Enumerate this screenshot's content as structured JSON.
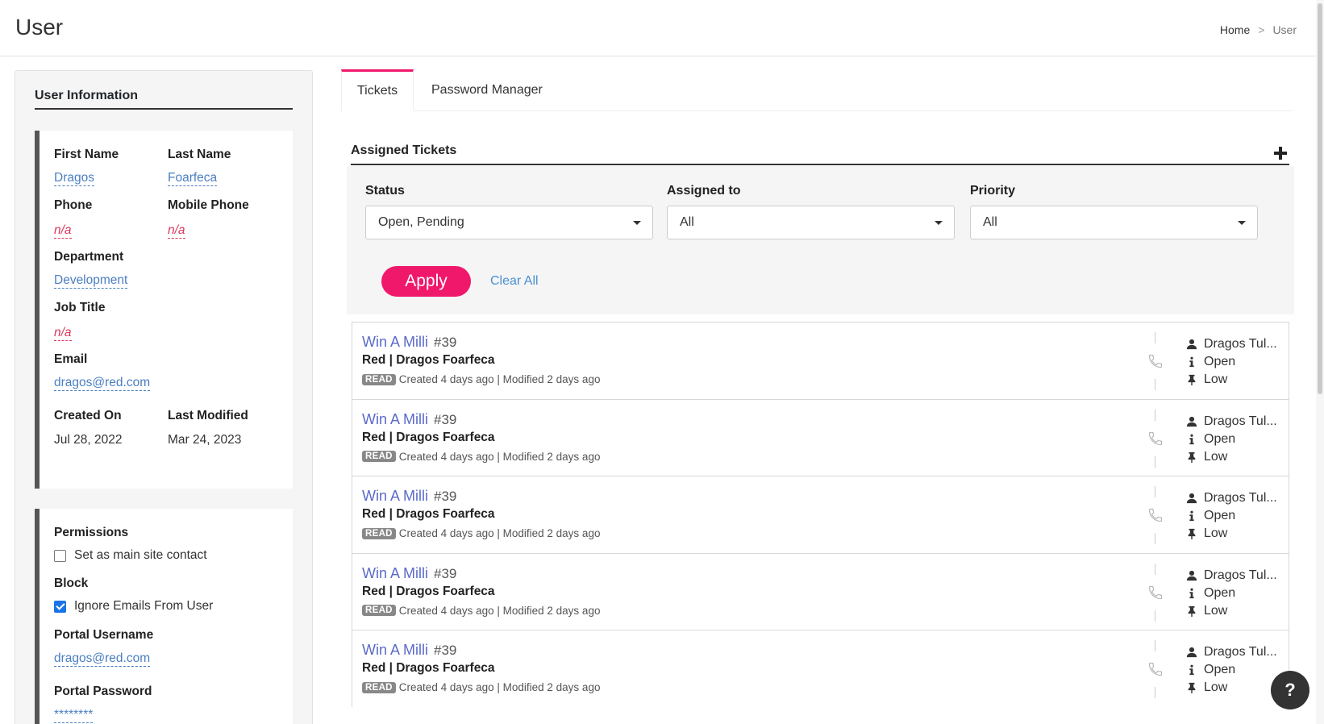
{
  "header": {
    "title": "User",
    "breadcrumb": {
      "home": "Home",
      "separator": ">",
      "current": "User"
    }
  },
  "user_info": {
    "section_title": "User Information",
    "first_name": {
      "label": "First Name",
      "value": "Dragos"
    },
    "last_name": {
      "label": "Last Name",
      "value": "Foarfeca"
    },
    "phone": {
      "label": "Phone",
      "value": "n/a"
    },
    "mobile_phone": {
      "label": "Mobile Phone",
      "value": "n/a"
    },
    "department": {
      "label": "Department",
      "value": "Development"
    },
    "job_title": {
      "label": "Job Title",
      "value": "n/a"
    },
    "email": {
      "label": "Email",
      "value": "dragos@red.com"
    },
    "created_on": {
      "label": "Created On",
      "value": "Jul 28, 2022"
    },
    "last_modified": {
      "label": "Last Modified",
      "value": "Mar 24, 2023"
    }
  },
  "permissions": {
    "label": "Permissions",
    "main_contact": {
      "label": "Set as main site contact",
      "checked": false
    },
    "block_label": "Block",
    "ignore_emails": {
      "label": "Ignore Emails From User",
      "checked": true
    },
    "portal_username": {
      "label": "Portal Username",
      "value": "dragos@red.com"
    },
    "portal_password": {
      "label": "Portal Password",
      "value": "********"
    }
  },
  "tabs": [
    {
      "label": "Tickets",
      "active": true
    },
    {
      "label": "Password Manager",
      "active": false
    }
  ],
  "tickets_section": {
    "title": "Assigned Tickets",
    "filters": {
      "status": {
        "label": "Status",
        "value": "Open, Pending"
      },
      "assigned_to": {
        "label": "Assigned to",
        "value": "All"
      },
      "priority": {
        "label": "Priority",
        "value": "All"
      }
    },
    "apply_label": "Apply",
    "clear_label": "Clear All"
  },
  "tickets": [
    {
      "title": "Win A Milli",
      "number": "#39",
      "subtitle": "Red | Dragos Foarfeca",
      "badge": "READ",
      "meta": "Created 4 days ago | Modified 2 days ago",
      "assignee": "Dragos Tul...",
      "status": "Open",
      "priority": "Low"
    },
    {
      "title": "Win A Milli",
      "number": "#39",
      "subtitle": "Red | Dragos Foarfeca",
      "badge": "READ",
      "meta": "Created 4 days ago | Modified 2 days ago",
      "assignee": "Dragos Tul...",
      "status": "Open",
      "priority": "Low"
    },
    {
      "title": "Win A Milli",
      "number": "#39",
      "subtitle": "Red | Dragos Foarfeca",
      "badge": "READ",
      "meta": "Created 4 days ago | Modified 2 days ago",
      "assignee": "Dragos Tul...",
      "status": "Open",
      "priority": "Low"
    },
    {
      "title": "Win A Milli",
      "number": "#39",
      "subtitle": "Red | Dragos Foarfeca",
      "badge": "READ",
      "meta": "Created 4 days ago | Modified 2 days ago",
      "assignee": "Dragos Tul...",
      "status": "Open",
      "priority": "Low"
    },
    {
      "title": "Win A Milli",
      "number": "#39",
      "subtitle": "Red | Dragos Foarfeca",
      "badge": "READ",
      "meta": "Created 4 days ago | Modified 2 days ago",
      "assignee": "Dragos Tul...",
      "status": "Open",
      "priority": "Low"
    }
  ],
  "help": {
    "label": "?"
  },
  "icons": {
    "add": "plus-icon",
    "phone": "phone-icon",
    "user": "user-icon",
    "info": "info-icon",
    "pin": "pin-icon",
    "caret": "caret-down-icon"
  },
  "colors": {
    "accent": "#f0186b",
    "link": "#4a7ec2",
    "ticket_title": "#5a6ac8",
    "na": "#d9385c"
  }
}
